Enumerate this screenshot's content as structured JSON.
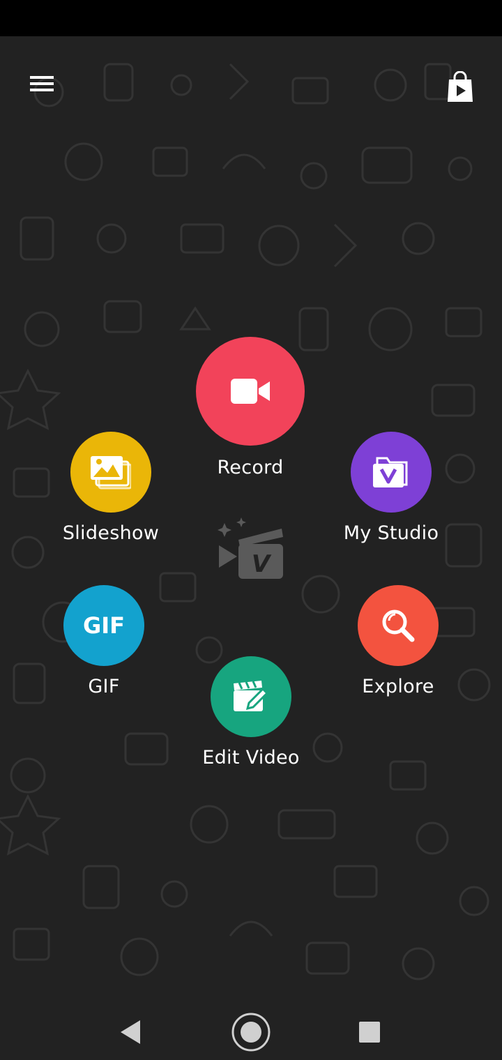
{
  "colors": {
    "background": "#222222",
    "record": "#f2435a",
    "slideshow": "#eab608",
    "my_studio": "#7e40d6",
    "gif": "#13a2ce",
    "explore": "#f3533f",
    "edit_video": "#17a57f"
  },
  "header": {
    "menu_icon": "hamburger-menu-icon",
    "store_icon": "shopping-bag-play-icon"
  },
  "actions": {
    "record": {
      "label": "Record",
      "icon": "video-camera-icon"
    },
    "slideshow": {
      "label": "Slideshow",
      "icon": "photo-stack-icon"
    },
    "my_studio": {
      "label": "My Studio",
      "icon": "studio-folder-icon"
    },
    "gif": {
      "label": "GIF",
      "icon": "gif-text-icon",
      "icon_text": "GIF"
    },
    "explore": {
      "label": "Explore",
      "icon": "magnifier-icon"
    },
    "edit_video": {
      "label": "Edit Video",
      "icon": "clapperboard-pencil-icon"
    }
  },
  "center_logo": {
    "letter": "V"
  },
  "nav": {
    "back_icon": "back-triangle-icon",
    "home_icon": "home-circle-icon",
    "recents_icon": "recents-square-icon"
  }
}
